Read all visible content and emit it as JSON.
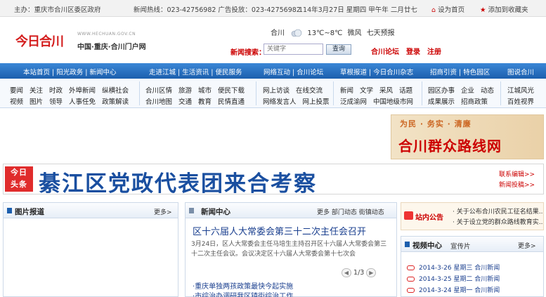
{
  "topbar": {
    "host": "主办：重庆市合川区委区政府",
    "hotline": "新闻热线：023-42756982 广告投放：023-42756982",
    "date": "114年3月27日 星期四 甲午年 二月廿七",
    "set_home": "设为首页",
    "bookmark": "添加到收藏夹"
  },
  "header": {
    "logo_text": "今日合川",
    "logo_url": "WWW.HECHUAN.GOV.CN",
    "logo_sub": "中国·重庆·合川门户网",
    "weather": {
      "city": "合川",
      "temp": "13℃~8℃",
      "wind": "微风",
      "forecast": "七天预报"
    },
    "search_label": "新闻搜索：",
    "search_placeholder": "关键字",
    "search_button": "查询",
    "forum": "合川论坛",
    "login": "登录",
    "register": "注册"
  },
  "nav": {
    "groups": [
      "本站首页 | 阳光政务 | 新闻中心",
      "走进江城 | 生活资讯 | 便民服务",
      "网络互动 | 合川论坛",
      "草根报道 | 今日合川杂志",
      "招商引资 | 特色园区",
      "图说合川"
    ],
    "sub": [
      {
        "row1": [
          "要闻",
          "关注",
          "时政",
          "外埠新闻",
          "纵横社会"
        ],
        "row2": [
          "视频",
          "图片",
          "领导",
          "人事任免",
          "政策解读"
        ]
      },
      {
        "row1": [
          "合川区情",
          "旅游",
          "城市",
          "便民下载"
        ],
        "row2": [
          "合川地图",
          "交通",
          "教育",
          "民情直通"
        ]
      },
      {
        "row1": [
          "网上访谈",
          "在线交流"
        ],
        "row2": [
          "网络发言人",
          "网上投票"
        ]
      },
      {
        "row1": [
          "新闻",
          "文学",
          "采风",
          "话题"
        ],
        "row2": [
          "泛成渝网",
          "中国地级市网"
        ]
      },
      {
        "row1": [
          "园区办事",
          "企业",
          "动态"
        ],
        "row2": [
          "成果展示",
          "招商政策"
        ]
      },
      {
        "row1": [
          "江城风光"
        ],
        "row2": [
          "百姓视界"
        ]
      }
    ]
  },
  "slogan_banner": {
    "top": "为民 · 务实 · 清廉",
    "main": "合川群众路线网"
  },
  "headline": {
    "tag_line1": "今日",
    "tag_line2": "头条",
    "text": "綦江区党政代表团来合考察",
    "contact": "联系编辑>>",
    "submit": "新闻投稿>>"
  },
  "photo_panel": {
    "title": "图片报道",
    "more": "更多>"
  },
  "news_panel": {
    "title": "新闻中心",
    "more": "更多  部门动态  街镇动态",
    "headline": "区十六届人大常委会第三十二次主任会召开",
    "summary": "3月24日，区人大常委会主任马培生主持召开区十六届人大常委会第三十二次主任会议。会议决定区十六届人大常委会第十七次会",
    "pager": "1/3",
    "items": [
      "·重庆单独两孩政策最快今起实施",
      "·市综治办调研我区镇街综治工作"
    ]
  },
  "notice_panel": {
    "title": "站内公告",
    "items": [
      "· 关于公布合川农民工征名结果..",
      "· 关于设立党的群众路线教育实.."
    ]
  },
  "video_panel": {
    "title": "视频中心",
    "tab2": "宣传片",
    "more": "更多>",
    "items": [
      "2014-3-26 星期三 合川新闻",
      "2014-3-25 星期二 合川新闻",
      "2014-3-24 星期一 合川新闻"
    ]
  },
  "colors": {
    "nav_blue": "#1c5fae",
    "headline_blue": "#1a4fa0",
    "accent_red": "#cc0000",
    "tag_red": "#e02c2c"
  }
}
